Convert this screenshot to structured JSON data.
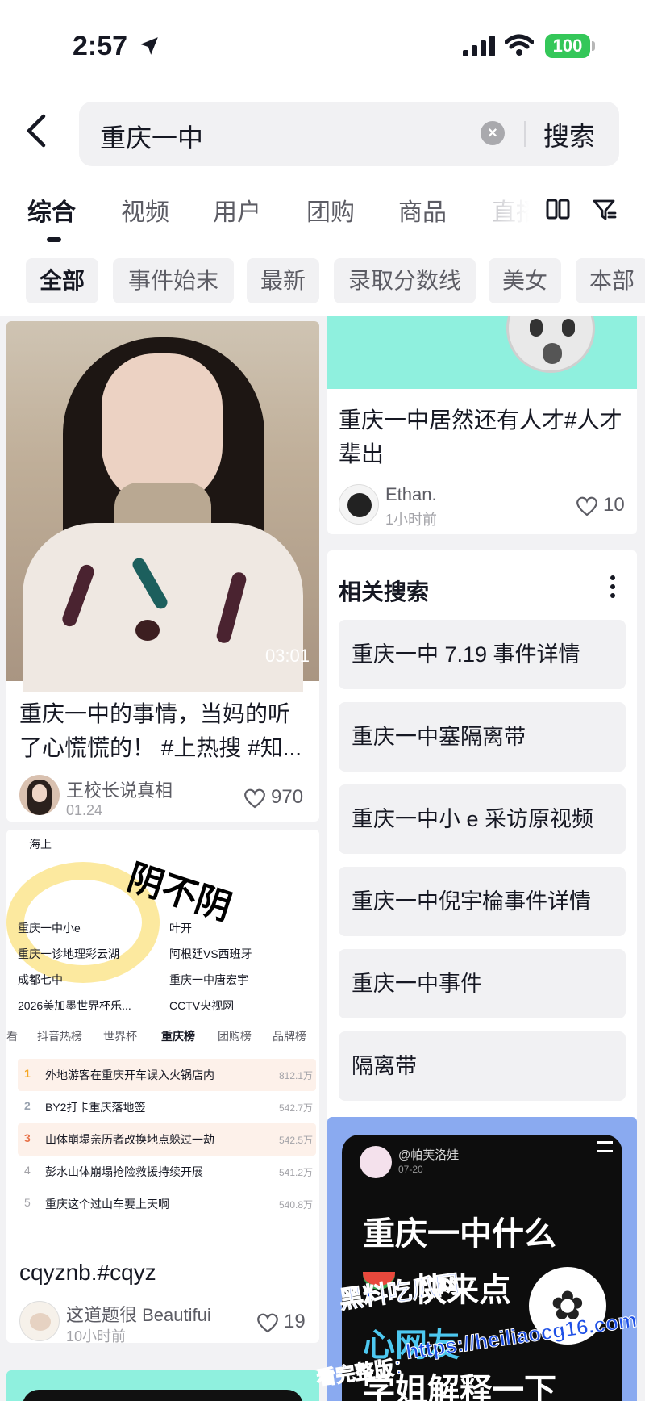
{
  "status": {
    "time": "2:57",
    "battery": "100"
  },
  "search": {
    "query": "重庆一中",
    "button": "搜索"
  },
  "tabs": [
    {
      "label": "综合"
    },
    {
      "label": "视频"
    },
    {
      "label": "用户"
    },
    {
      "label": "团购"
    },
    {
      "label": "商品"
    },
    {
      "label": "直播"
    }
  ],
  "chips": [
    "全部",
    "事件始末",
    "最新",
    "录取分数线",
    "美女",
    "本部"
  ],
  "cards": {
    "video1": {
      "duration": "03:01",
      "title": "重庆一中的事情，当妈的听了心慌慌的！ #上热搜 #知...",
      "author": "王校长说真相",
      "date": "01.24",
      "likes": "970"
    },
    "post1": {
      "title": "重庆一中居然还有人才#人才辈出",
      "author": "Ethan.",
      "time": "1小时前",
      "likes": "10"
    },
    "screenshot": {
      "overlay_text": "阴不阴",
      "search_top": "海上",
      "search_items": [
        "重庆一中小e",
        "叶开",
        "重庆一诊地理彩云湖",
        "阿根廷VS西班牙",
        "成都七中",
        "重庆一中唐宏宇",
        "2026美加墨世界杯乐...",
        "CCTV央视网"
      ],
      "hot_tabs": [
        "看",
        "抖音热榜",
        "世界杯",
        "重庆榜",
        "团购榜",
        "品牌榜"
      ],
      "hot_list": [
        {
          "rank": "1",
          "text": "外地游客在重庆开车误入火锅店内",
          "count": "812.1万"
        },
        {
          "rank": "2",
          "text": "BY2打卡重庆落地签",
          "count": "542.7万"
        },
        {
          "rank": "3",
          "text": "山体崩塌亲历者改换地点躲过一劫",
          "count": "542.5万"
        },
        {
          "rank": "4",
          "text": "彭水山体崩塌抢险救援持续开展",
          "count": "541.2万"
        },
        {
          "rank": "5",
          "text": "重庆这个过山车要上天啊",
          "count": "540.8万"
        }
      ],
      "title": "cqyznb.#cqyz",
      "author": "这道题很 Beautifui",
      "time": "10小时前",
      "likes": "19"
    },
    "post2": {
      "user": "@帕芙洛娃",
      "date": "07-20",
      "line1": "重庆一中什么",
      "line2": "快来点",
      "line3": "心网友",
      "line4": "学姐解释一下"
    }
  },
  "related": {
    "title": "相关搜索",
    "items": [
      "重庆一中 7.19 事件详情",
      "重庆一中塞隔离带",
      "重庆一中小 e 采访原视频",
      "重庆一中倪宇棆事件详情",
      "重庆一中事件",
      "隔离带"
    ]
  },
  "watermark": {
    "line1": "黑料吃瓜网",
    "line2": "https://heiliaocg16.com",
    "prefix": "看完整版："
  },
  "colors": {
    "accent_cyan": "#8ff0de",
    "battery_green": "#34c759",
    "watermark_blue": "#1e50e6"
  }
}
